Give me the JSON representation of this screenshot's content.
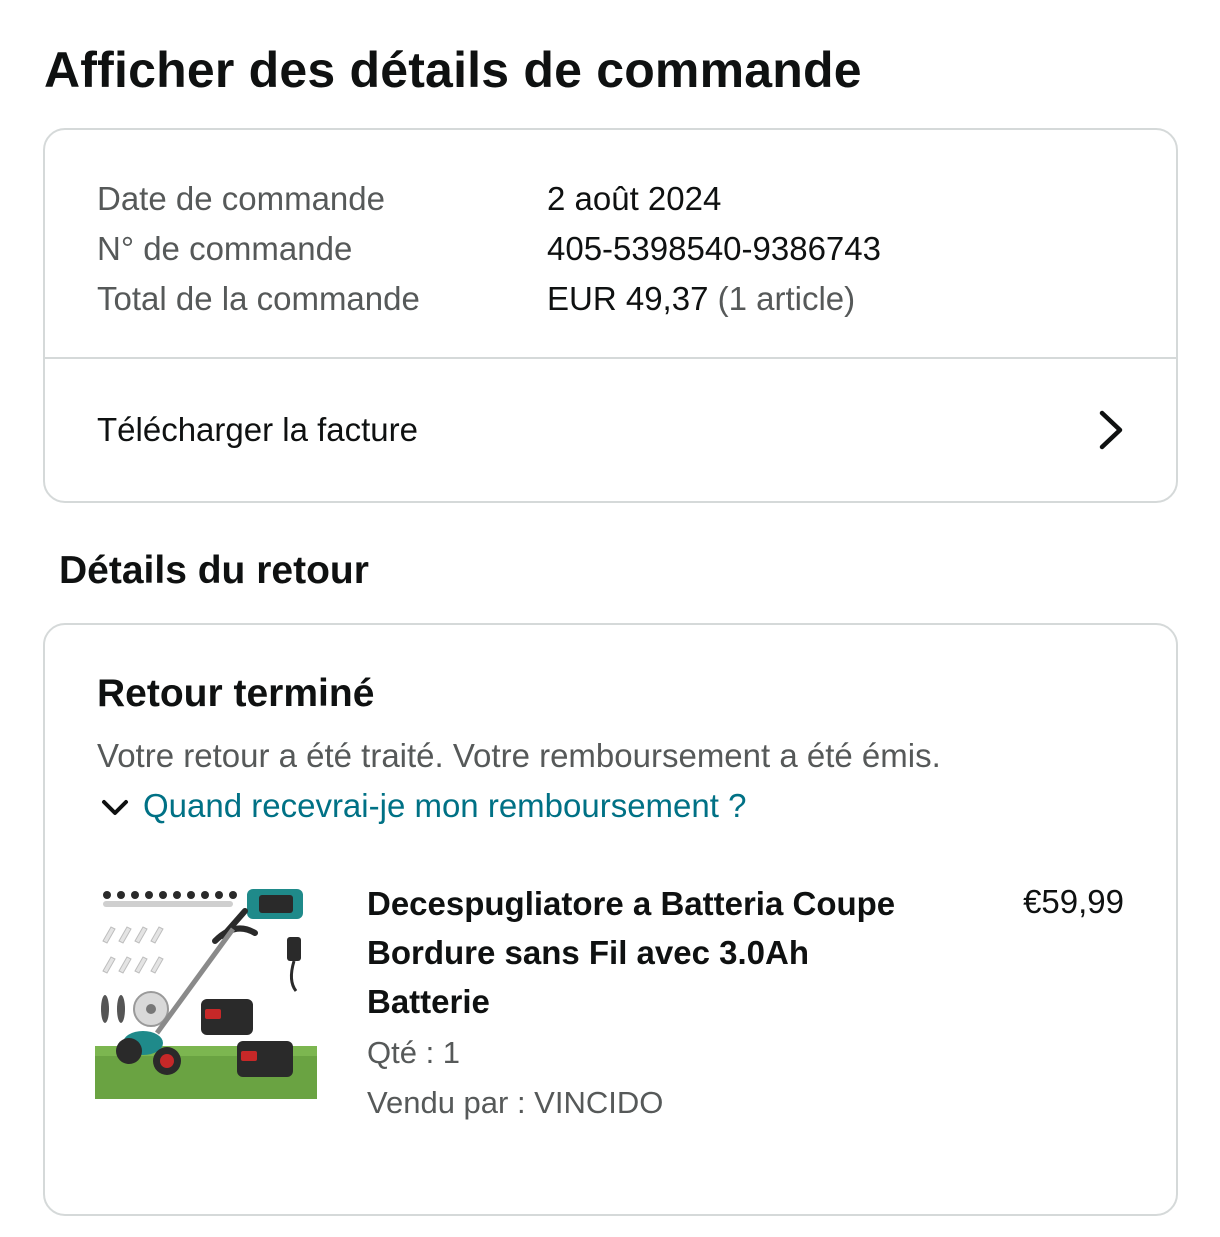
{
  "page": {
    "title": "Afficher des détails de commande"
  },
  "order_summary": {
    "rows": [
      {
        "label": "Date de commande",
        "value": "2 août 2024",
        "extra": ""
      },
      {
        "label": "N° de commande",
        "value": "405-5398540-9386743",
        "extra": ""
      },
      {
        "label": "Total de la commande",
        "value": "EUR 49,37",
        "extra": " (1 article)"
      }
    ],
    "invoice_label": "Télécharger la facture",
    "invoice_icon": "chevron-right-icon"
  },
  "return_details": {
    "section_title": "Détails du retour",
    "status": "Retour terminé",
    "message": "Votre retour a été traité. Votre remboursement a été émis.",
    "refund_link": "Quand recevrai-je mon remboursement ?",
    "refund_link_icon": "chevron-down-icon",
    "link_color": "#007185",
    "item": {
      "image_icon": "product-thumbnail",
      "title": "Decespugliatore a Batteria Coupe Bordure sans Fil avec 3.0Ah Batterie",
      "quantity": "Qté : 1",
      "seller": "Vendu par : VINCIDO",
      "price": "€59,99"
    }
  }
}
